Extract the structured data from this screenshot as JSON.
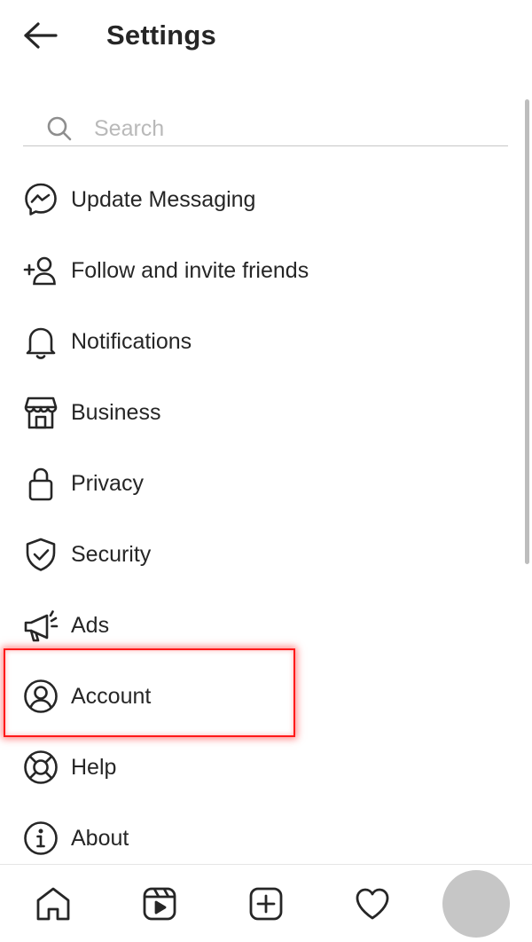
{
  "header": {
    "title": "Settings",
    "back_icon": "arrow-left-icon"
  },
  "search": {
    "placeholder": "Search",
    "value": "",
    "icon": "search-icon"
  },
  "menu": {
    "items": [
      {
        "label": "Update Messaging",
        "icon": "messenger-icon"
      },
      {
        "label": "Follow and invite friends",
        "icon": "add-person-icon"
      },
      {
        "label": "Notifications",
        "icon": "bell-icon"
      },
      {
        "label": "Business",
        "icon": "storefront-icon"
      },
      {
        "label": "Privacy",
        "icon": "lock-icon"
      },
      {
        "label": "Security",
        "icon": "shield-check-icon"
      },
      {
        "label": "Ads",
        "icon": "megaphone-icon"
      },
      {
        "label": "Account",
        "icon": "user-circle-icon"
      },
      {
        "label": "Help",
        "icon": "lifebuoy-icon"
      },
      {
        "label": "About",
        "icon": "info-icon"
      }
    ]
  },
  "highlight": {
    "target": "Account",
    "color": "#ff1a1a"
  },
  "bottom_nav": {
    "items": [
      "home-icon",
      "reels-icon",
      "create-icon",
      "heart-icon",
      "profile-avatar"
    ]
  },
  "colors": {
    "text": "#262626",
    "placeholder": "#b9b9b9",
    "divider": "#c7c7c7",
    "avatar": "#c6c6c6"
  }
}
